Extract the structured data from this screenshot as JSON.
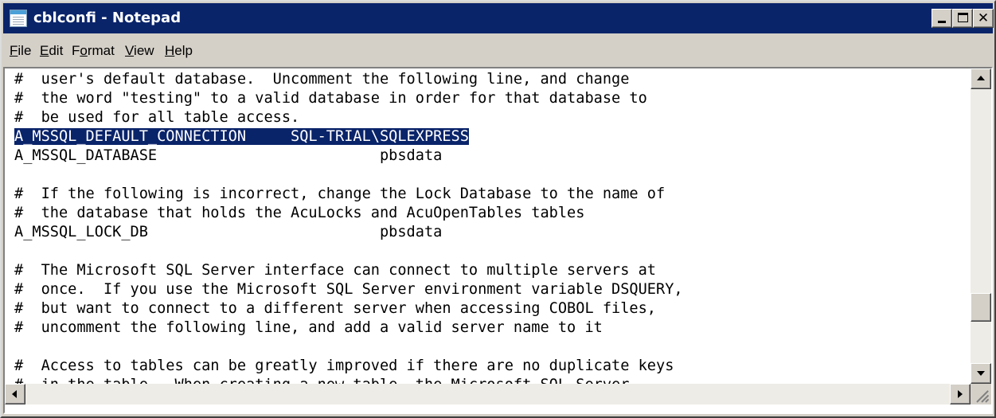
{
  "window": {
    "title": "cblconfi - Notepad"
  },
  "menu": {
    "items": [
      {
        "accel": "F",
        "rest": "ile"
      },
      {
        "accel": "E",
        "rest": "dit"
      },
      {
        "pre": "F",
        "accel": "o",
        "rest": "rmat"
      },
      {
        "accel": "V",
        "rest": "iew"
      },
      {
        "accel": "H",
        "rest": "elp"
      }
    ]
  },
  "editor": {
    "lines": [
      {
        "text": "#  user's default database.  Uncomment the following line, and change"
      },
      {
        "text": "#  the word \"testing\" to a valid database in order for that database to"
      },
      {
        "text": "#  be used for all table access."
      },
      {
        "text": "",
        "selected": "A_MSSQL_DEFAULT_CONNECTION     SQL-TRIAL\\SQLEXPRESS"
      },
      {
        "text": "A_MSSQL_DATABASE                         pbsdata"
      },
      {
        "text": ""
      },
      {
        "text": "#  If the following is incorrect, change the Lock Database to the name of"
      },
      {
        "text": "#  the database that holds the AcuLocks and AcuOpenTables tables"
      },
      {
        "text": "A_MSSQL_LOCK_DB                          pbsdata"
      },
      {
        "text": ""
      },
      {
        "text": "#  The Microsoft SQL Server interface can connect to multiple servers at"
      },
      {
        "text": "#  once.  If you use the Microsoft SQL Server environment variable DSQUERY,"
      },
      {
        "text": "#  but want to connect to a different server when accessing COBOL files,"
      },
      {
        "text": "#  uncomment the following line, and add a valid server name to it"
      },
      {
        "text": ""
      },
      {
        "text": "#  Access to tables can be greatly improved if there are no duplicate keys"
      },
      {
        "text": "#  in the table.  When creating a new table, the Microsoft SQL Server"
      }
    ],
    "vertical_scroll_position": 0.83
  },
  "colors": {
    "title_bar": "#0a246a",
    "selection": "#0a246a",
    "chrome": "#d4d0c8"
  }
}
